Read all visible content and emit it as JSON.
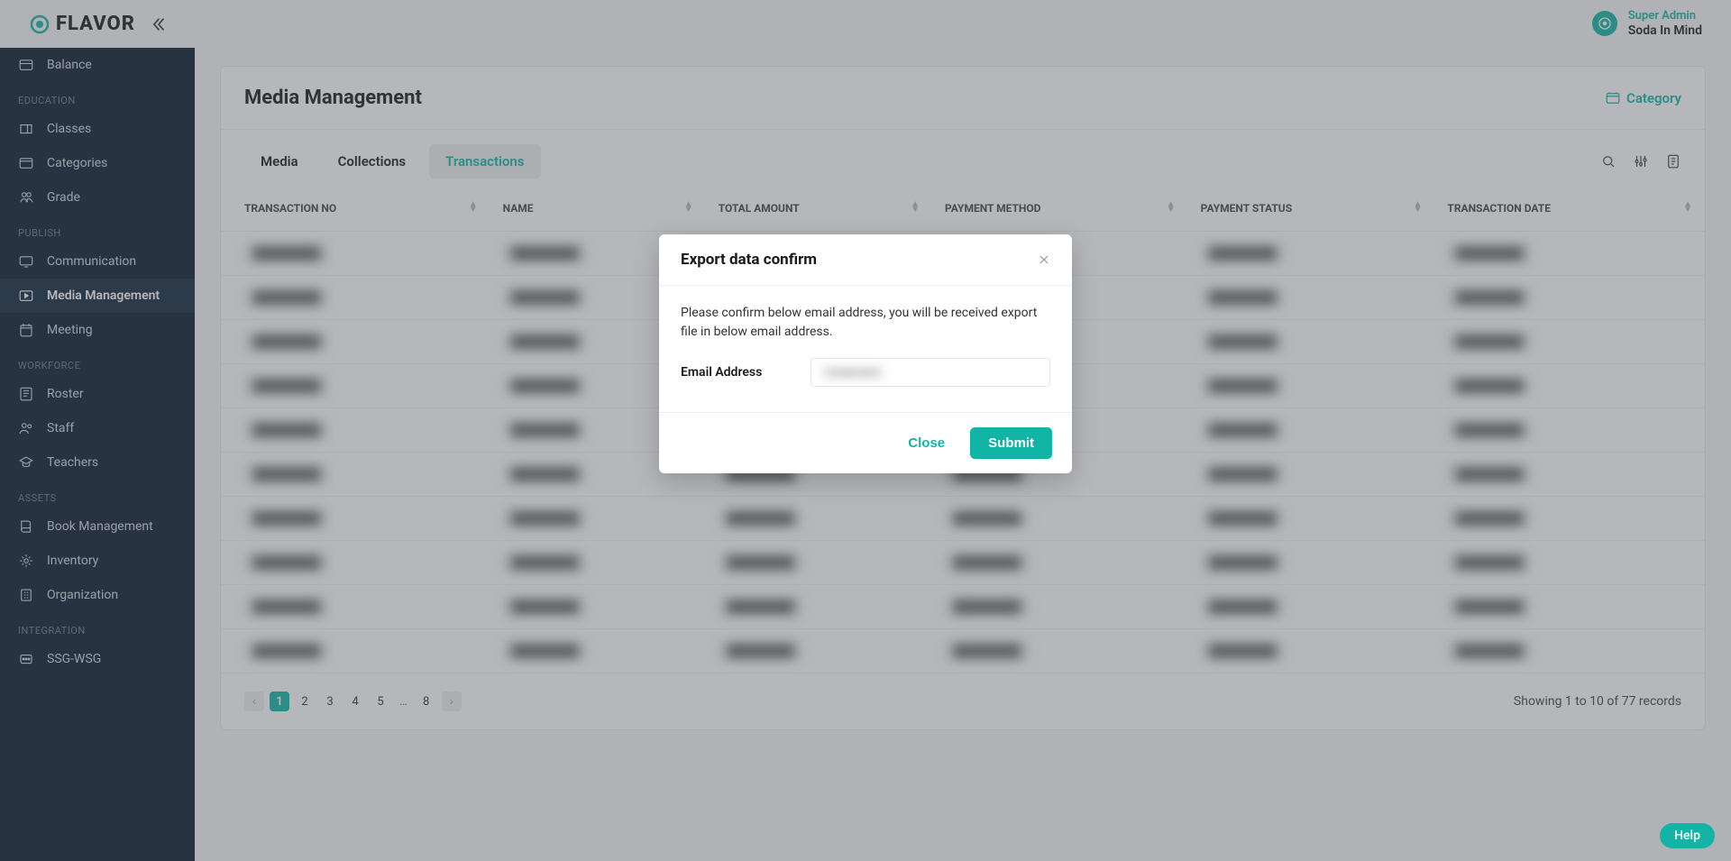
{
  "topbar": {
    "brand": "FLAVOR",
    "user_role": "Super Admin",
    "user_name": "Soda In Mind"
  },
  "sidebar": {
    "items_top": [
      {
        "label": "Balance",
        "icon": "balance-icon"
      }
    ],
    "section_education": "EDUCATION",
    "items_education": [
      {
        "label": "Classes",
        "icon": "classes-icon"
      },
      {
        "label": "Categories",
        "icon": "categories-icon"
      },
      {
        "label": "Grade",
        "icon": "grade-icon"
      }
    ],
    "section_publish": "PUBLISH",
    "items_publish": [
      {
        "label": "Communication",
        "icon": "communication-icon"
      },
      {
        "label": "Media Management",
        "icon": "media-management-icon",
        "active": true
      },
      {
        "label": "Meeting",
        "icon": "meeting-icon"
      }
    ],
    "section_workforce": "WORKFORCE",
    "items_workforce": [
      {
        "label": "Roster",
        "icon": "roster-icon"
      },
      {
        "label": "Staff",
        "icon": "staff-icon"
      },
      {
        "label": "Teachers",
        "icon": "teachers-icon"
      }
    ],
    "section_assets": "ASSETS",
    "items_assets": [
      {
        "label": "Book Management",
        "icon": "book-icon"
      },
      {
        "label": "Inventory",
        "icon": "inventory-icon"
      },
      {
        "label": "Organization",
        "icon": "organization-icon"
      }
    ],
    "section_integration": "INTEGRATION",
    "items_integration": [
      {
        "label": "SSG-WSG",
        "icon": "ssg-icon"
      }
    ]
  },
  "page": {
    "title": "Media Management",
    "category_link": "Category",
    "tabs": [
      {
        "label": "Media"
      },
      {
        "label": "Collections"
      },
      {
        "label": "Transactions",
        "active": true
      }
    ],
    "columns": [
      "TRANSACTION NO",
      "NAME",
      "TOTAL AMOUNT",
      "PAYMENT METHOD",
      "PAYMENT STATUS",
      "TRANSACTION DATE"
    ],
    "row_count": 10,
    "pager": {
      "pages": [
        "1",
        "2",
        "3",
        "4",
        "5",
        "…",
        "8"
      ],
      "active": "1"
    },
    "records_text": "Showing 1 to 10 of 77 records"
  },
  "modal": {
    "title": "Export data confirm",
    "body_text": "Please confirm below email address, you will be received export file in below email address.",
    "field_label": "Email Address",
    "email_value": "(redacted)",
    "close_label": "Close",
    "submit_label": "Submit"
  },
  "help": {
    "label": "Help"
  }
}
